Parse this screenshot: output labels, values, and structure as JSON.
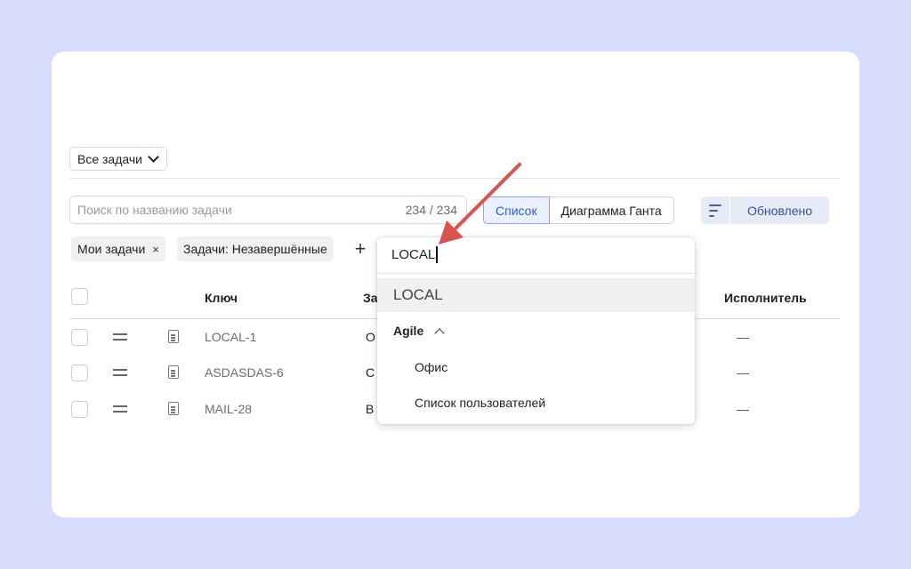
{
  "toolbar": {
    "view_select": "Все задачи",
    "search_placeholder": "Поиск по названию задачи",
    "counter": "234 / 234",
    "view_list": "Список",
    "view_gantt": "Диаграмма Ганта",
    "sort_label": "Обновлено"
  },
  "filters": {
    "chips": [
      "Мои задачи",
      "Задачи: Незавершённые"
    ],
    "remove_glyph": "×",
    "add_glyph": "+"
  },
  "table": {
    "headers": {
      "key": "Ключ",
      "task_cut": "За",
      "assignee": "Исполнитель"
    },
    "rows": [
      {
        "key": "LOCAL-1",
        "task_cut": "О",
        "assignee": "—"
      },
      {
        "key": "ASDASDAS-6",
        "task_cut": "С",
        "assignee": "—"
      },
      {
        "key": "MAIL-28",
        "task_cut": "В",
        "assignee": "—"
      }
    ]
  },
  "dropdown": {
    "input_value": "LOCAL",
    "highlighted_option": "LOCAL",
    "group_label": "Agile",
    "group_items": [
      "Офис",
      "Список пользователей"
    ]
  },
  "colors": {
    "background": "#d6dcfb",
    "annotation_arrow": "#d9534f",
    "accent": "#2f5fcf"
  }
}
